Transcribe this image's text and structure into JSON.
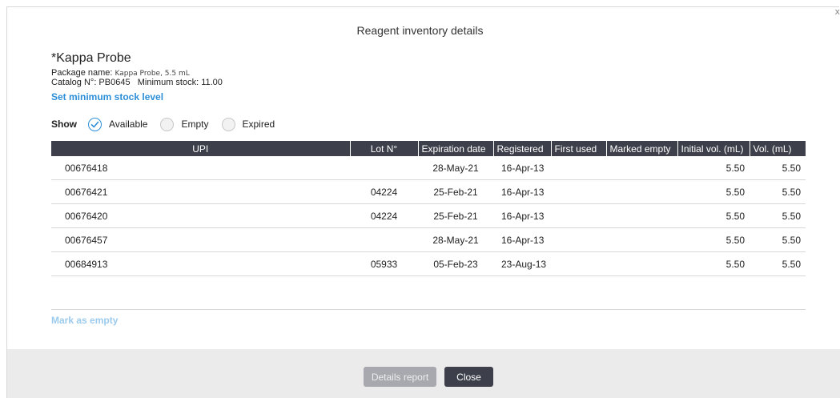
{
  "dialog": {
    "title": "Reagent inventory details",
    "close_glyph": "x"
  },
  "reagent": {
    "name": "*Kappa Probe",
    "package_label": "Package name:",
    "package_value": "Kappa Probe, 5.5 mL",
    "catalog_line": "Catalog N°: PB0645   Minimum stock: 11.00"
  },
  "links": {
    "set_min_stock": "Set minimum stock level",
    "mark_as_empty": "Mark as empty"
  },
  "filter": {
    "label": "Show",
    "options": [
      {
        "label": "Available",
        "checked": true
      },
      {
        "label": "Empty",
        "checked": false
      },
      {
        "label": "Expired",
        "checked": false
      }
    ]
  },
  "table": {
    "columns": [
      "UPI",
      "Lot N°",
      "Expiration date",
      "Registered",
      "First used",
      "Marked empty",
      "Initial vol. (mL)",
      "Vol. (mL)"
    ],
    "rows": [
      [
        "00676418",
        "",
        "28-May-21",
        "16-Apr-13",
        "",
        "",
        "5.50",
        "5.50"
      ],
      [
        "00676421",
        "04224",
        "25-Feb-21",
        "16-Apr-13",
        "",
        "",
        "5.50",
        "5.50"
      ],
      [
        "00676420",
        "04224",
        "25-Feb-21",
        "16-Apr-13",
        "",
        "",
        "5.50",
        "5.50"
      ],
      [
        "00676457",
        "",
        "28-May-21",
        "16-Apr-13",
        "",
        "",
        "5.50",
        "5.50"
      ],
      [
        "00684913",
        "05933",
        "05-Feb-23",
        "23-Aug-13",
        "",
        "",
        "5.50",
        "5.50"
      ]
    ]
  },
  "footer": {
    "details_report": "Details report",
    "close": "Close"
  },
  "colors": {
    "accent": "#2c8fd8",
    "header_bg": "#3d3f4a",
    "footer_bg": "#ebebeb",
    "disabled_link": "#9ccbee"
  }
}
